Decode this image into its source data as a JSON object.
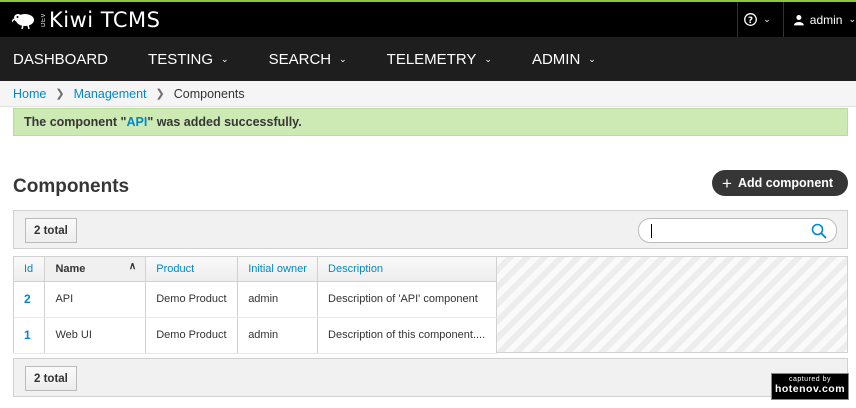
{
  "brand": {
    "name": "Kiwi TCMS",
    "version": "DEV"
  },
  "topbar": {
    "help_icon": "question-circle-icon",
    "user": "admin"
  },
  "nav": [
    "DASHBOARD",
    "TESTING",
    "SEARCH",
    "TELEMETRY",
    "ADMIN"
  ],
  "breadcrumb": {
    "home": "Home",
    "management": "Management",
    "current": "Components"
  },
  "alert": {
    "prefix": "The component \"",
    "link": "API",
    "suffix": "\" was added successfully."
  },
  "page": {
    "title": "Components",
    "add_button": "Add component"
  },
  "toolbar": {
    "total": "2 total",
    "search_value": ""
  },
  "table": {
    "columns": [
      "Id",
      "Name",
      "Product",
      "Initial owner",
      "Description"
    ],
    "sorted_column": "Name",
    "rows": [
      {
        "id": "2",
        "name": "API",
        "product": "Demo Product",
        "owner": "admin",
        "description": "Description of 'API' component"
      },
      {
        "id": "1",
        "name": "Web UI",
        "product": "Demo Product",
        "owner": "admin",
        "description": "Description of this component...."
      }
    ]
  },
  "watermark": {
    "line1": "captured by",
    "line2": "hotenov.com"
  },
  "colors": {
    "accent": "#0088ce",
    "alert_bg": "#cdeab5",
    "topbar_border": "#8cc63e",
    "nav_bg": "#1e1e1e"
  }
}
